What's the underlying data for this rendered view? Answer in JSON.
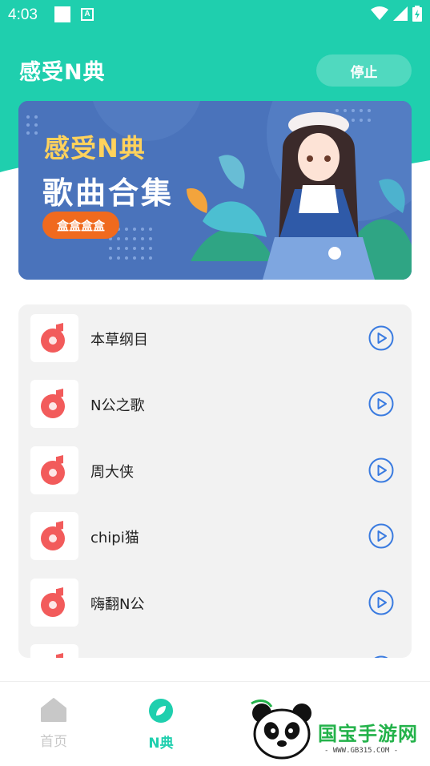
{
  "status_bar": {
    "time": "4:03"
  },
  "header": {
    "title": "感受N典",
    "stop_label": "停止"
  },
  "banner": {
    "line1": "感受N典",
    "line2": "歌曲合集",
    "tag": "盒盒盒盒"
  },
  "songs": [
    {
      "title": "本草纲目"
    },
    {
      "title": "N公之歌"
    },
    {
      "title": "周大侠"
    },
    {
      "title": "chipi猫"
    },
    {
      "title": "嗨翻N公"
    }
  ],
  "nav": {
    "home": {
      "label": "首页"
    },
    "ndian": {
      "label": "N典"
    }
  },
  "watermark": {
    "text": "国宝手游网",
    "url": "- WWW.GB315.COM -"
  },
  "colors": {
    "primary": "#1fcfae",
    "banner_blue": "#4a73bb",
    "accent_yellow": "#ffd25c",
    "tag_orange": "#f06a1e",
    "music_red": "#f25b5b",
    "play_blue": "#3a7be0",
    "nav_inactive": "#c8c8c8",
    "nav_active": "#1fcfae"
  }
}
